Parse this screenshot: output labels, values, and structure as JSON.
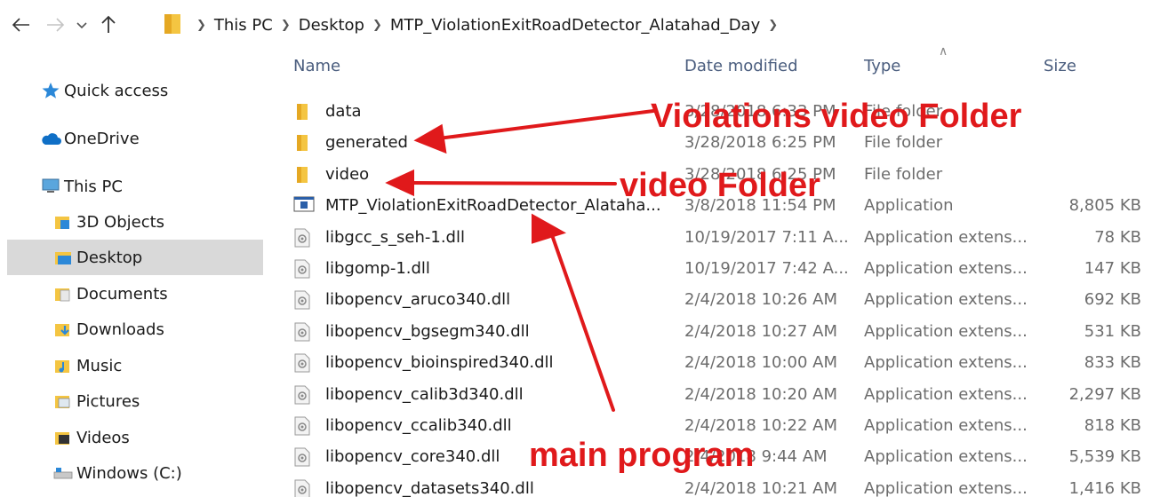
{
  "nav": {
    "back_icon": "arrow-left-icon",
    "forward_icon": "arrow-right-icon",
    "recent_icon": "chevron-down-icon",
    "up_icon": "arrow-up-icon"
  },
  "breadcrumb": [
    "This PC",
    "Desktop",
    "MTP_ViolationExitRoadDetector_Alatahad_Day"
  ],
  "sidebar": {
    "items": [
      {
        "label": "Quick access",
        "icon": "star-icon"
      },
      {
        "label": "OneDrive",
        "icon": "cloud-icon"
      },
      {
        "label": "This PC",
        "icon": "computer-icon"
      },
      {
        "label": "3D Objects",
        "icon": "cube-folder-icon"
      },
      {
        "label": "Desktop",
        "icon": "desktop-folder-icon",
        "selected": true
      },
      {
        "label": "Documents",
        "icon": "documents-folder-icon"
      },
      {
        "label": "Downloads",
        "icon": "downloads-folder-icon"
      },
      {
        "label": "Music",
        "icon": "music-folder-icon"
      },
      {
        "label": "Pictures",
        "icon": "pictures-folder-icon"
      },
      {
        "label": "Videos",
        "icon": "videos-folder-icon"
      },
      {
        "label": "Windows (C:)",
        "icon": "drive-icon"
      }
    ]
  },
  "columns": {
    "name": "Name",
    "date": "Date modified",
    "type": "Type",
    "size": "Size"
  },
  "files": [
    {
      "name": "data",
      "date": "3/28/2018 6:33 PM",
      "type": "File folder",
      "size": "",
      "icon": "folder-icon"
    },
    {
      "name": "generated",
      "date": "3/28/2018 6:25 PM",
      "type": "File folder",
      "size": "",
      "icon": "folder-icon"
    },
    {
      "name": "video",
      "date": "3/28/2018 6:25 PM",
      "type": "File folder",
      "size": "",
      "icon": "folder-icon"
    },
    {
      "name": "MTP_ViolationExitRoadDetector_Alataha...",
      "date": "3/8/2018 11:54 PM",
      "type": "Application",
      "size": "8,805 KB",
      "icon": "application-icon"
    },
    {
      "name": "libgcc_s_seh-1.dll",
      "date": "10/19/2017 7:11 A...",
      "type": "Application extens...",
      "size": "78 KB",
      "icon": "dll-icon"
    },
    {
      "name": "libgomp-1.dll",
      "date": "10/19/2017 7:42 A...",
      "type": "Application extens...",
      "size": "147 KB",
      "icon": "dll-icon"
    },
    {
      "name": "libopencv_aruco340.dll",
      "date": "2/4/2018 10:26 AM",
      "type": "Application extens...",
      "size": "692 KB",
      "icon": "dll-icon"
    },
    {
      "name": "libopencv_bgsegm340.dll",
      "date": "2/4/2018 10:27 AM",
      "type": "Application extens...",
      "size": "531 KB",
      "icon": "dll-icon"
    },
    {
      "name": "libopencv_bioinspired340.dll",
      "date": "2/4/2018 10:00 AM",
      "type": "Application extens...",
      "size": "833 KB",
      "icon": "dll-icon"
    },
    {
      "name": "libopencv_calib3d340.dll",
      "date": "2/4/2018 10:20 AM",
      "type": "Application extens...",
      "size": "2,297 KB",
      "icon": "dll-icon"
    },
    {
      "name": "libopencv_ccalib340.dll",
      "date": "2/4/2018 10:22 AM",
      "type": "Application extens...",
      "size": "818 KB",
      "icon": "dll-icon"
    },
    {
      "name": "libopencv_core340.dll",
      "date": "2/4/2018 9:44 AM",
      "type": "Application extens...",
      "size": "5,539 KB",
      "icon": "dll-icon"
    },
    {
      "name": "libopencv_datasets340.dll",
      "date": "2/4/2018 10:21 AM",
      "type": "Application extens...",
      "size": "1,416 KB",
      "icon": "dll-icon"
    }
  ],
  "annotations": {
    "violations": "Violations video Folder",
    "video": "video Folder",
    "main": "main program",
    "color": "#e0191b"
  }
}
